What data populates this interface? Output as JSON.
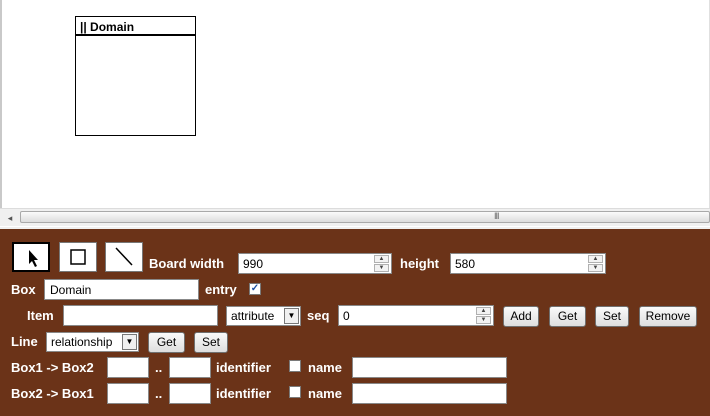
{
  "board": {
    "box_title": "|| Domain"
  },
  "scrollbar": {
    "left_arrow": "◂",
    "grip": "III"
  },
  "tools": [
    {
      "name": "select-tool",
      "icon": "arrow-pointer"
    },
    {
      "name": "box-tool",
      "icon": "square"
    },
    {
      "name": "line-tool",
      "icon": "diagonal-line"
    }
  ],
  "board_size": {
    "width_label": "Board width",
    "width_value": "990",
    "height_label": "height",
    "height_value": "580"
  },
  "box": {
    "label": "Box",
    "value": "Domain",
    "entry_label": "entry",
    "entry_checked": true
  },
  "item": {
    "label": "Item",
    "value": "",
    "type_value": "attribute",
    "seq_label": "seq",
    "seq_value": "0",
    "add": "Add",
    "get": "Get",
    "set": "Set",
    "remove": "Remove"
  },
  "line": {
    "label": "Line",
    "type_value": "relationship",
    "get": "Get",
    "set": "Set"
  },
  "box1_box2": {
    "label": "Box1 -> Box2",
    "from": "",
    "sep": "..",
    "to": "",
    "identifier_label": "identifier",
    "identifier_checked": false,
    "name_label": "name",
    "name_value": ""
  },
  "box2_box1": {
    "label": "Box2 -> Box1",
    "from": "",
    "sep": "..",
    "to": "",
    "identifier_label": "identifier",
    "identifier_checked": false,
    "name_label": "name",
    "name_value": ""
  }
}
